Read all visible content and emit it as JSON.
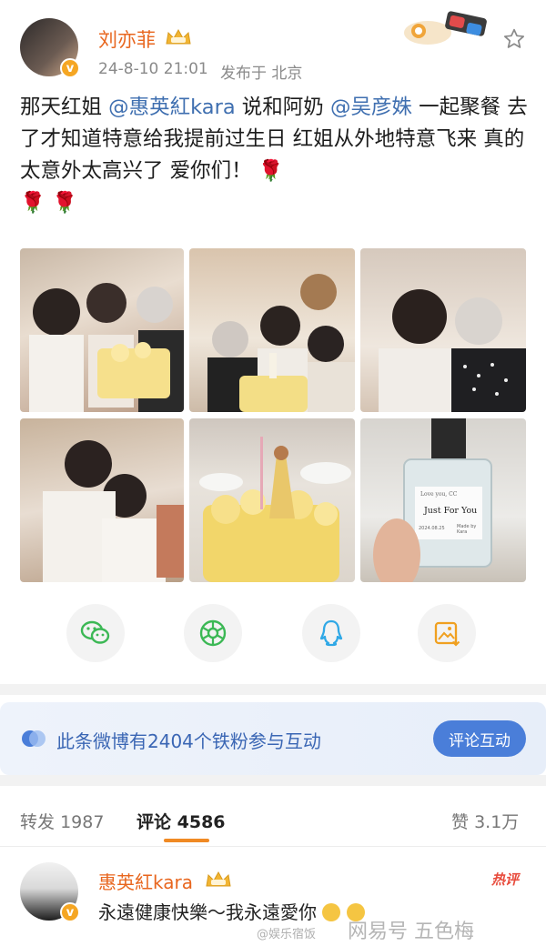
{
  "post": {
    "author": "刘亦菲",
    "date": "24-8-10 21:01",
    "location": "发布于 北京",
    "text": {
      "p1": "那天红姐 ",
      "mention1": "@惠英紅kara",
      "p2": " 说和阿奶 ",
      "mention2": "@吴彦姝",
      "p3": " 一起聚餐 去了才知道特意给我提前过生日 红姐从外地特意飞来 真的太意外太高兴了 爱你们！"
    },
    "rose_emoji": "🌹"
  },
  "photos": {
    "bottle_caption": "Just For You",
    "bottle_small_top": "Love you, CC",
    "bottle_small_left": "2024.08.25",
    "bottle_small_right": "Made by Kara"
  },
  "banner": {
    "text": "此条微博有2404个铁粉参与互动",
    "button": "评论互动"
  },
  "tabs": {
    "repost_label": "转发",
    "repost_count": "1987",
    "comment_label": "评论",
    "comment_count": "4586",
    "like_label": "赞",
    "like_count": "3.1万"
  },
  "comment": {
    "author": "惠英紅kara",
    "text": "永遠健康快樂～我永遠愛你",
    "hot_badge": "热评"
  },
  "watermark": {
    "left": "@娱乐宿饭",
    "right": "网易号 五色梅"
  },
  "colors": {
    "name_orange": "#e8661e",
    "mention_blue": "#3f6fb0",
    "accent_blue": "#4a7ed9",
    "hot_red": "#e84c3d"
  }
}
